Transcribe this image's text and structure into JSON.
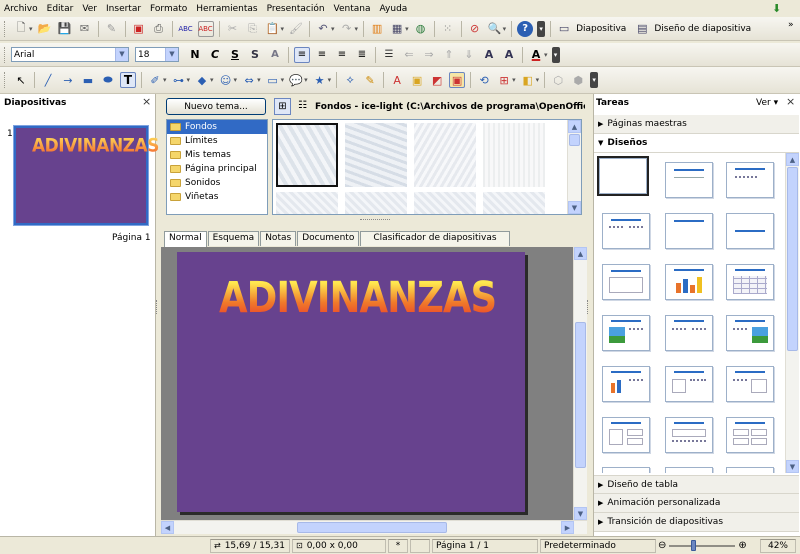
{
  "menu": [
    "Archivo",
    "Editar",
    "Ver",
    "Insertar",
    "Formato",
    "Herramientas",
    "Presentación",
    "Ventana",
    "Ayuda"
  ],
  "toolbar1": {
    "slide_label": "Diapositiva",
    "design_label": "Diseño de diapositiva"
  },
  "toolbar2": {
    "font_name": "Arial",
    "font_size": "18",
    "bold": "N",
    "italic": "C",
    "underline": "S"
  },
  "slides_panel": {
    "title": "Diapositivas",
    "slide_number": "1",
    "thumb_text": "ADIVINANZAS",
    "page_label": "Página 1"
  },
  "gallery": {
    "new_theme_button": "Nuevo tema...",
    "path_title": "Fondos - ice-light (C:\\Archivos de programa\\OpenOffice.org",
    "themes": [
      "Fondos",
      "Límites",
      "Mis temas",
      "Página principal",
      "Sonidos",
      "Viñetas"
    ],
    "selected_theme": "Fondos"
  },
  "view_tabs": [
    "Normal",
    "Esquema",
    "Notas",
    "Documento",
    "Clasificador de diapositivas"
  ],
  "active_view_tab": "Normal",
  "slide": {
    "title_text": "ADIVINANZAS"
  },
  "tasks_panel": {
    "title": "Tareas",
    "view_menu": "Ver",
    "sections": {
      "master_pages": "Páginas maestras",
      "layouts": "Diseños",
      "table_design": "Diseño de tabla",
      "custom_animation": "Animación personalizada",
      "slide_transition": "Transición de diapositivas"
    }
  },
  "status": {
    "position": "15,69 / 15,31",
    "size": "0,00 x 0,00",
    "modified": "*",
    "page": "Página 1 / 1",
    "layout_name": "Predeterminado",
    "zoom": "42%"
  },
  "colors": {
    "slide_bg": "#67428e",
    "selection_blue": "#316ac5"
  }
}
